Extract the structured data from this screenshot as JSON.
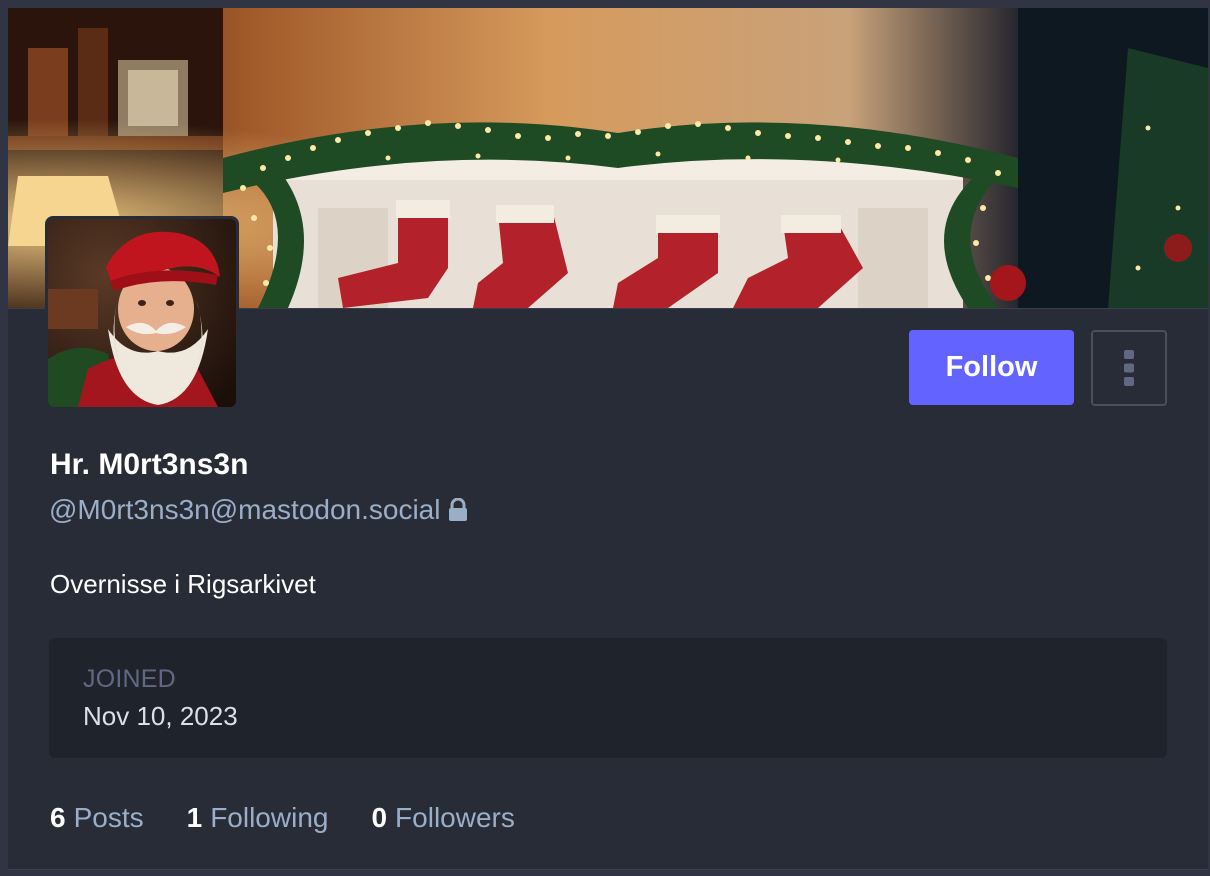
{
  "profile": {
    "display_name": "Hr. M0rt3ns3n",
    "handle": "@M0rt3ns3n@mastodon.social",
    "bio": "Overnisse i Rigsarkivet",
    "locked_icon": "lock-icon"
  },
  "actions": {
    "follow_label": "Follow",
    "menu_icon": "ellipsis-vertical-icon"
  },
  "fields": {
    "joined_label": "JOINED",
    "joined_value": "Nov 10, 2023"
  },
  "stats": [
    {
      "count": "6",
      "label": "Posts"
    },
    {
      "count": "1",
      "label": "Following"
    },
    {
      "count": "0",
      "label": "Followers"
    }
  ],
  "colors": {
    "background": "#282c37",
    "accent": "#6364ff",
    "secondary_text": "#9baec8",
    "field_background": "#1f232b"
  }
}
